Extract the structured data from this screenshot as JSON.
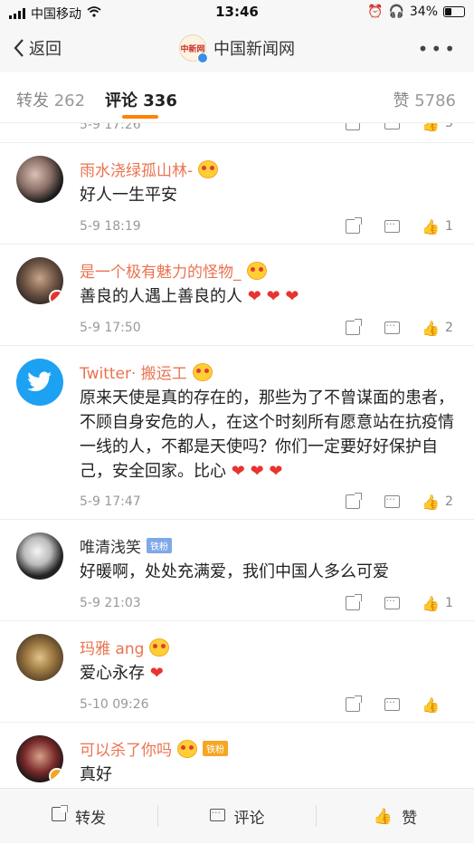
{
  "status": {
    "carrier": "中国移动",
    "time": "13:46",
    "battery": "34%"
  },
  "nav": {
    "back_label": "返回",
    "title": "中国新闻网",
    "logo_text": "中新网"
  },
  "tabs": {
    "repost_label": "转发",
    "repost_count": "262",
    "comment_label": "评论",
    "comment_count": "336",
    "like_label": "赞",
    "like_count": "5786"
  },
  "prev_time": "5-9 17:26",
  "prev_likes": "3",
  "comments": [
    {
      "name": "雨水浇绿孤山林-",
      "text": "好人一生平安",
      "time": "5-9 18:19",
      "likes": "1"
    },
    {
      "name": "是一个极有魅力的怪物_",
      "text": "善良的人遇上善良的人 ❤️ ❤️ ❤️",
      "time": "5-9 17:50",
      "likes": "2"
    },
    {
      "name": "Twitter· 搬运工",
      "text": "原来天使是真的存在的，那些为了不曾谋面的患者，不顾自身安危的人，在这个时刻所有愿意站在抗疫情一线的人，不都是天使吗？你们一定要好好保护自己，安全回家。比心 ❤️ ❤️ ❤️",
      "time": "5-9 17:47",
      "likes": "2"
    },
    {
      "name": "唯清浅笑",
      "badge": "铁粉",
      "text": "好暖啊，处处充满爱，我们中国人多么可爱",
      "time": "5-9 21:03",
      "likes": "1"
    },
    {
      "name": "玛雅 ang",
      "text": "爱心永存 ❤️",
      "time": "5-10 09:26",
      "likes": ""
    },
    {
      "name": "可以杀了你吗",
      "badge": "铁粉",
      "text": "真好",
      "time": "",
      "likes": ""
    }
  ],
  "bottom": {
    "repost": "转发",
    "comment": "评论",
    "like": "赞"
  },
  "colors": {
    "accent": "#ff8200",
    "name": "#eb7350",
    "heart": "#e8332f"
  }
}
